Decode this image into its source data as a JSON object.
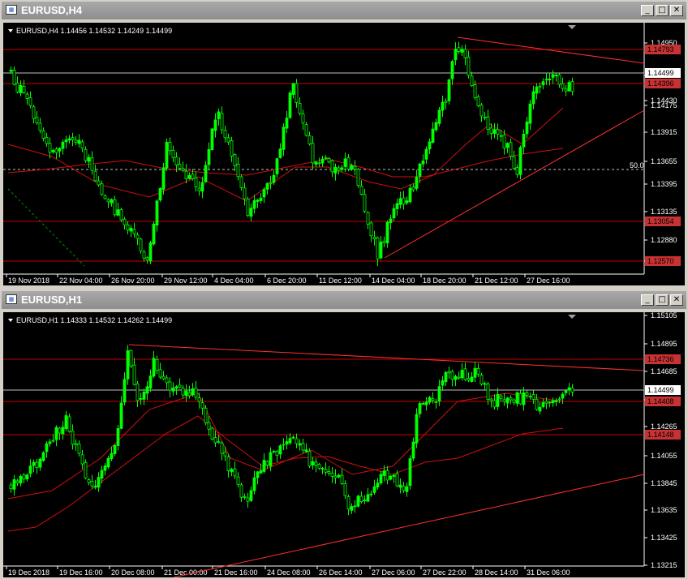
{
  "windows": [
    {
      "title": "EURUSD,H4",
      "header": "EURUSD,H4  1.14456 1.14532 1.14249 1.14499",
      "price_axis": [
        "1.14950",
        "1.14690",
        "1.14430",
        "1.14175",
        "1.13915",
        "1.13655",
        "1.13395",
        "1.13135",
        "1.12880",
        "1.12620"
      ],
      "time_axis": [
        "19 Nov 2018",
        "22 Nov 04:00",
        "26 Nov 20:00",
        "29 Nov 12:00",
        "4 Dec 04:00",
        "6 Dec 20:00",
        "11 Dec 12:00",
        "14 Dec 04:00",
        "18 Dec 20:00",
        "21 Dec 12:00",
        "27 Dec 16:00"
      ],
      "current_price": "1.14499",
      "level_labels": [
        "1.14793",
        "1.14396",
        "1.13054",
        "1.12570"
      ],
      "fib_label": "50.0",
      "range": [
        1.1262,
        1.1495
      ]
    },
    {
      "title": "EURUSD,H1",
      "header": "EURUSD,H1  1.14333 1.14532 1.14262 1.14499",
      "price_axis": [
        "1.15105",
        "1.14895",
        "1.14685",
        "1.14475",
        "1.14265",
        "1.14055",
        "1.13845",
        "1.13635",
        "1.13425",
        "1.13215"
      ],
      "time_axis": [
        "19 Dec 2018",
        "19 Dec 16:00",
        "20 Dec 08:00",
        "21 Dec 00:00",
        "21 Dec 16:00",
        "24 Dec 08:00",
        "26 Dec 14:00",
        "27 Dec 06:00",
        "27 Dec 22:00",
        "28 Dec 14:00",
        "31 Dec 06:00"
      ],
      "current_price": "1.14499",
      "level_labels": [
        "1.14736",
        "1.14408",
        "1.14148"
      ],
      "range": [
        1.13215,
        1.15105
      ]
    }
  ],
  "colors": {
    "bull": "#00ff00",
    "bear": "#000000",
    "candle_outline": "#00ff00",
    "level_line": "#c80000",
    "trend_line": "#ff3030",
    "ma_line": "#d01010",
    "current_line": "#c0c0c0",
    "label_bg": "#c83232"
  },
  "icons": [
    "chart-window-icon",
    "minimize-icon",
    "restore-icon",
    "close-icon",
    "collapse-triangle-icon"
  ]
}
